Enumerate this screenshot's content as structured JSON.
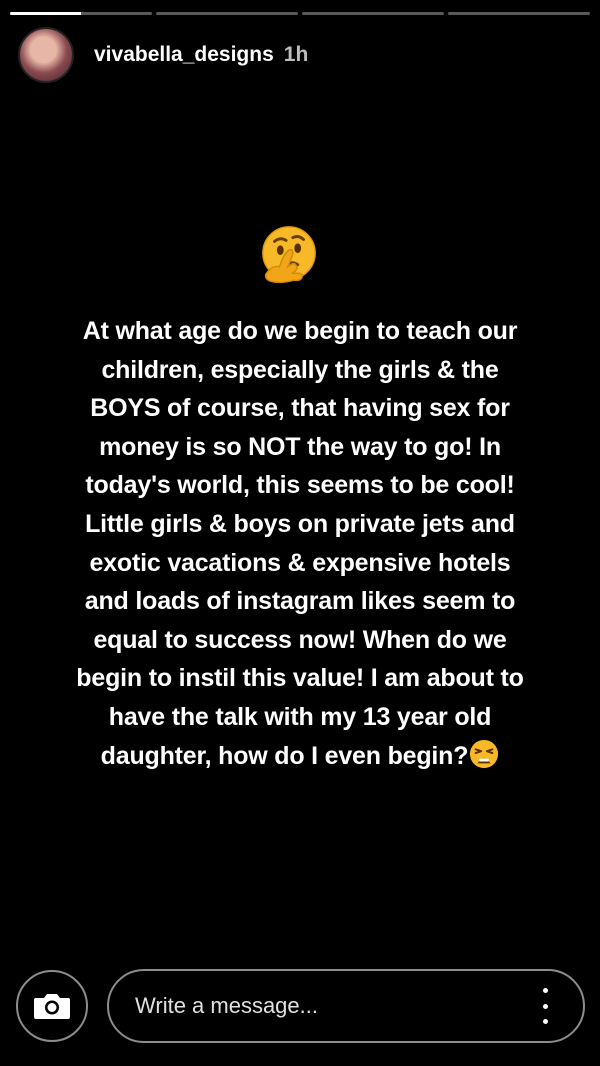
{
  "progress": {
    "segments": [
      0.5,
      0,
      0,
      0
    ]
  },
  "header": {
    "username": "vivabella_designs",
    "time": "1h"
  },
  "story": {
    "emoji_top": "thinking-face",
    "lines": [
      "At what age do we begin to teach our",
      "children, especially the girls & the",
      "BOYS of course, that having sex for",
      "money is so NOT the way to go! In",
      "today's world, this seems to be cool!",
      "Little girls & boys on private jets and",
      "exotic vacations & expensive hotels",
      "and loads of instagram likes seem to",
      "equal to success now! When do we",
      "begin to instil this value! I am about to",
      "have the talk with my 13 year old",
      "daughter, how do I even begin?"
    ],
    "emoji_end": "tired-face"
  },
  "reply": {
    "placeholder": "Write a message..."
  },
  "icons": {
    "camera": "camera-icon",
    "more": "more-vertical-icon"
  },
  "colors": {
    "background": "#000000",
    "text": "#ffffff",
    "time": "#bdbdbd",
    "emoji": "#f7b928"
  }
}
